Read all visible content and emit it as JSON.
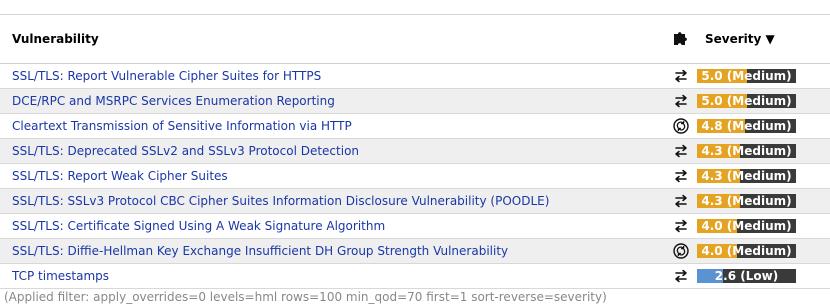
{
  "table": {
    "header": {
      "vulnerability": "Vulnerability",
      "qod_icon": "puzzle-piece-icon",
      "severity": "Severity ▼"
    },
    "rows": [
      {
        "name": "SSL/TLS: Report Vulnerable Cipher Suites for HTTPS",
        "qod_icon": "arrows-exchange-icon",
        "severity": "5.0 (Medium)",
        "score": 5.0,
        "level": "medium"
      },
      {
        "name": "DCE/RPC and MSRPC Services Enumeration Reporting",
        "qod_icon": "arrows-exchange-icon",
        "severity": "5.0 (Medium)",
        "score": 5.0,
        "level": "medium"
      },
      {
        "name": "Cleartext Transmission of Sensitive Information via HTTP",
        "qod_icon": "refresh-circle-icon",
        "severity": "4.8 (Medium)",
        "score": 4.8,
        "level": "medium"
      },
      {
        "name": "SSL/TLS: Deprecated SSLv2 and SSLv3 Protocol Detection",
        "qod_icon": "arrows-exchange-icon",
        "severity": "4.3 (Medium)",
        "score": 4.3,
        "level": "medium"
      },
      {
        "name": "SSL/TLS: Report Weak Cipher Suites",
        "qod_icon": "arrows-exchange-icon",
        "severity": "4.3 (Medium)",
        "score": 4.3,
        "level": "medium"
      },
      {
        "name": "SSL/TLS: SSLv3 Protocol CBC Cipher Suites Information Disclosure Vulnerability (POODLE)",
        "qod_icon": "arrows-exchange-icon",
        "severity": "4.3 (Medium)",
        "score": 4.3,
        "level": "medium"
      },
      {
        "name": "SSL/TLS: Certificate Signed Using A Weak Signature Algorithm",
        "qod_icon": "arrows-exchange-icon",
        "severity": "4.0 (Medium)",
        "score": 4.0,
        "level": "medium"
      },
      {
        "name": "SSL/TLS: Diffie-Hellman Key Exchange Insufficient DH Group Strength Vulnerability",
        "qod_icon": "refresh-circle-icon",
        "severity": "4.0 (Medium)",
        "score": 4.0,
        "level": "medium"
      },
      {
        "name": "TCP timestamps",
        "qod_icon": "arrows-exchange-icon",
        "severity": "2.6 (Low)",
        "score": 2.6,
        "level": "low"
      }
    ]
  },
  "colors": {
    "medium": "#e5a323",
    "low": "#5a93cf",
    "bar_bg": "#3a3a3a",
    "link": "#1a37a8"
  },
  "filter_text": "(Applied filter: apply_overrides=0 levels=hml rows=100 min_qod=70 first=1 sort-reverse=severity)"
}
